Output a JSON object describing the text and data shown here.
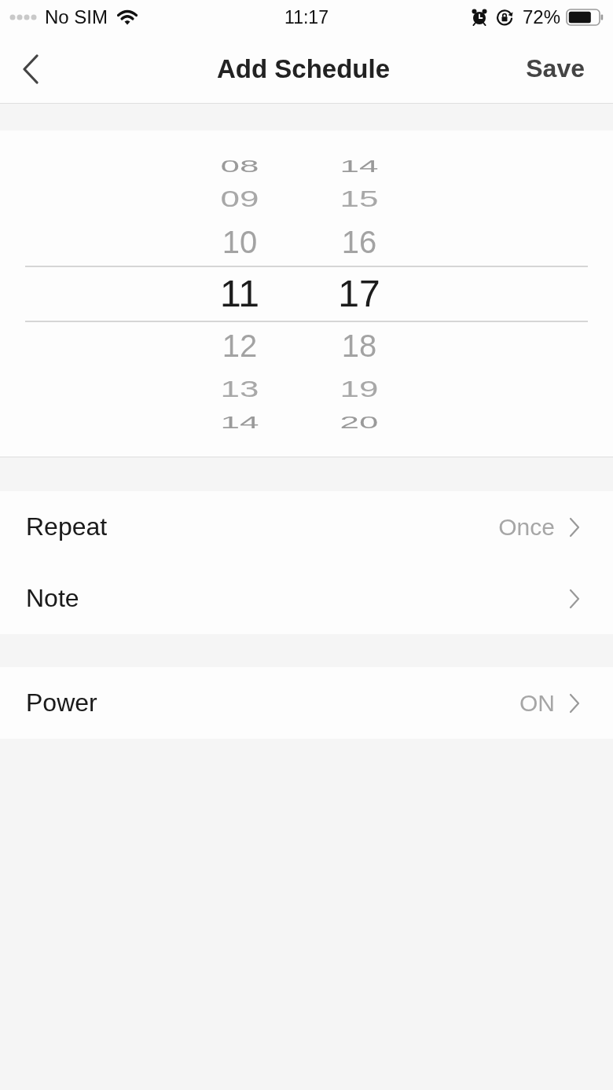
{
  "status_bar": {
    "carrier": "No SIM",
    "time": "11:17",
    "battery": "72%"
  },
  "nav_bar": {
    "title": "Add Schedule",
    "action": "Save"
  },
  "time_picker": {
    "columns": [
      {
        "items": [
          {
            "label": "08",
            "selected": false
          },
          {
            "label": "09",
            "selected": false
          },
          {
            "label": "10",
            "selected": false
          },
          {
            "label": "11",
            "selected": true
          },
          {
            "label": "12",
            "selected": false
          },
          {
            "label": "13",
            "selected": false
          },
          {
            "label": "14",
            "selected": false
          }
        ]
      },
      {
        "items": [
          {
            "label": "14",
            "selected": false
          },
          {
            "label": "15",
            "selected": false
          },
          {
            "label": "16",
            "selected": false
          },
          {
            "label": "17",
            "selected": true
          },
          {
            "label": "18",
            "selected": false
          },
          {
            "label": "19",
            "selected": false
          },
          {
            "label": "20",
            "selected": false
          }
        ]
      }
    ]
  },
  "settings_groups": [
    {
      "rows": [
        {
          "label": "Repeat",
          "value": "Once"
        },
        {
          "label": "Note"
        }
      ]
    },
    {
      "rows": [
        {
          "label": "Power",
          "value": "ON"
        }
      ]
    }
  ]
}
